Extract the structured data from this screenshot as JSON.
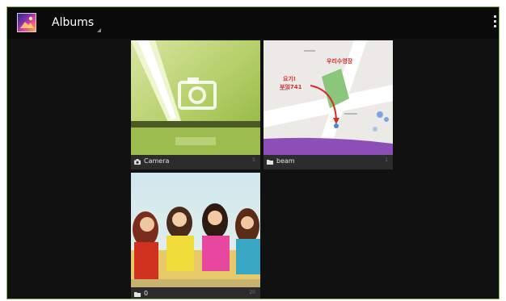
{
  "actionbar": {
    "title": "Albums",
    "app_icon": "gallery-icon",
    "menu_icon": "overflow-menu-icon"
  },
  "albums": [
    {
      "name": "Camera",
      "count": "5",
      "kind_icon": "camera-icon"
    },
    {
      "name": "beam",
      "count": "1",
      "kind_icon": "folder-icon"
    },
    {
      "name": "0",
      "count": "20",
      "kind_icon": "folder-icon"
    }
  ],
  "map_thumbnail_text": {
    "handwritten_line1": "요기!",
    "handwritten_line2": "부엌741",
    "place_label": "우리수영장"
  },
  "colors": {
    "background": "#111111",
    "actionbar": "#0a0a0a",
    "label_bar": "#2c2c2c",
    "frame": "#7db33d"
  }
}
